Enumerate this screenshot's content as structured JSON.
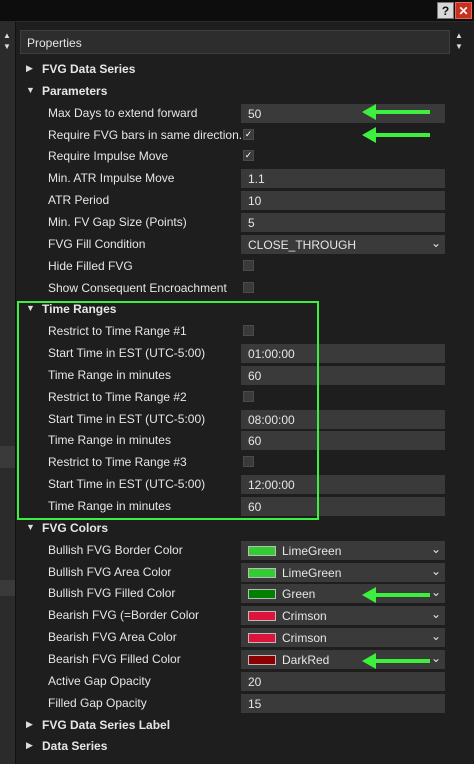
{
  "window": {
    "help_label": "?",
    "close_label": "✕"
  },
  "header": {
    "title": "Properties"
  },
  "colors": {
    "accent": "#3ef03e",
    "lime_green": "#32cd32",
    "green": "#008000",
    "crimson": "#dc143c",
    "dark_red": "#8b0000"
  },
  "rows": [
    {
      "type": "category",
      "label": "FVG Data Series",
      "expanded": false
    },
    {
      "type": "category",
      "label": "Parameters",
      "expanded": true
    },
    {
      "type": "prop",
      "label": "Max Days to extend forward",
      "value": "50"
    },
    {
      "type": "prop",
      "label": "Require FVG bars in same direction.",
      "check": true
    },
    {
      "type": "prop",
      "label": "Require Impulse Move",
      "check": true
    },
    {
      "type": "prop",
      "label": "Min. ATR Impulse Move",
      "value": "1.1"
    },
    {
      "type": "prop",
      "label": "ATR Period",
      "value": "10"
    },
    {
      "type": "prop",
      "label": "Min. FV Gap Size (Points)",
      "value": "5"
    },
    {
      "type": "prop",
      "label": "FVG Fill Condition",
      "value": "CLOSE_THROUGH",
      "select": true
    },
    {
      "type": "prop",
      "label": "Hide Filled FVG",
      "check": false
    },
    {
      "type": "prop",
      "label": "Show Consequent Encroachment",
      "check": false
    },
    {
      "type": "category",
      "label": "Time Ranges",
      "expanded": true
    },
    {
      "type": "prop",
      "label": "Restrict to Time Range #1",
      "check": false
    },
    {
      "type": "prop",
      "label": "Start Time in EST (UTC-5:00)",
      "value": "01:00:00"
    },
    {
      "type": "prop",
      "label": "Time Range in minutes",
      "value": "60"
    },
    {
      "type": "prop",
      "label": "Restrict to Time Range #2",
      "check": false
    },
    {
      "type": "prop",
      "label": "Start Time in EST (UTC-5:00)",
      "value": "08:00:00"
    },
    {
      "type": "prop",
      "label": "Time Range in minutes",
      "value": "60"
    },
    {
      "type": "prop",
      "label": "Restrict to Time Range #3",
      "check": false
    },
    {
      "type": "prop",
      "label": "Start Time in EST (UTC-5:00)",
      "value": "12:00:00"
    },
    {
      "type": "prop",
      "label": "Time Range in minutes",
      "value": "60"
    },
    {
      "type": "category",
      "label": "FVG Colors",
      "expanded": true
    },
    {
      "type": "prop",
      "label": "Bullish FVG Border Color",
      "value": "LimeGreen",
      "swatch": "#32cd32",
      "select": true
    },
    {
      "type": "prop",
      "label": "Bullish FVG Area Color",
      "value": "LimeGreen",
      "swatch": "#32cd32",
      "select": true
    },
    {
      "type": "prop",
      "label": "Bullish FVG Filled Color",
      "value": "Green",
      "swatch": "#008000",
      "select": true
    },
    {
      "type": "prop",
      "label": "Bearish FVG (=Border Color",
      "value": "Crimson",
      "swatch": "#dc143c",
      "select": true
    },
    {
      "type": "prop",
      "label": "Bearish FVG Area Color",
      "value": "Crimson",
      "swatch": "#dc143c",
      "select": true
    },
    {
      "type": "prop",
      "label": "Bearish FVG Filled Color",
      "value": "DarkRed",
      "swatch": "#8b0000",
      "select": true
    },
    {
      "type": "prop",
      "label": "Active Gap Opacity",
      "value": "20"
    },
    {
      "type": "prop",
      "label": "Filled Gap Opacity",
      "value": "15"
    },
    {
      "type": "category",
      "label": "FVG Data Series Label",
      "expanded": false
    },
    {
      "type": "category",
      "label": "Data Series",
      "expanded": false
    }
  ]
}
